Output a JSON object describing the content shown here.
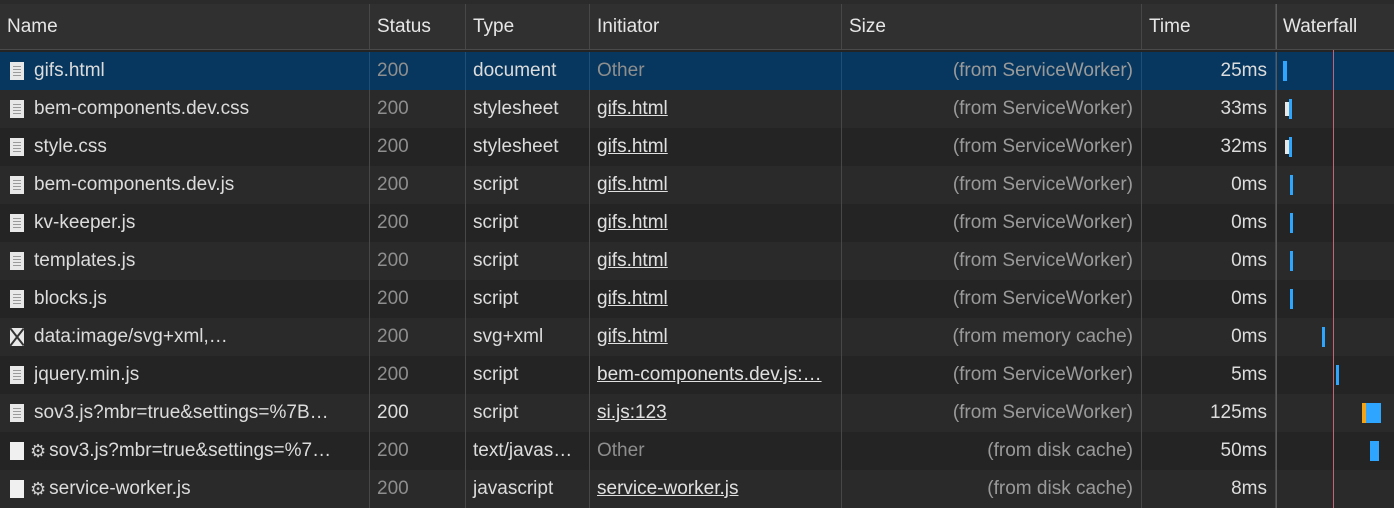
{
  "headers": {
    "name": "Name",
    "status": "Status",
    "type": "Type",
    "initiator": "Initiator",
    "size": "Size",
    "time": "Time",
    "waterfall": "Waterfall"
  },
  "rows": [
    {
      "name": "gifs.html",
      "icon": "document-icon",
      "status": "200",
      "type": "document",
      "initiator": "Other",
      "initiator_link": false,
      "size": "(from ServiceWorker)",
      "time": "25",
      "time_unit": "ms",
      "wf_start": 0.0,
      "wf_len": 0.03,
      "selected": true
    },
    {
      "name": "bem-components.dev.css",
      "icon": "document-icon",
      "status": "200",
      "type": "stylesheet",
      "initiator": "gifs.html",
      "initiator_link": true,
      "size": "(from ServiceWorker)",
      "time": "33",
      "time_unit": "ms",
      "wf_start": 0.05,
      "wf_len": 0.03
    },
    {
      "name": "style.css",
      "icon": "document-icon",
      "status": "200",
      "type": "stylesheet",
      "initiator": "gifs.html",
      "initiator_link": true,
      "size": "(from ServiceWorker)",
      "time": "32",
      "time_unit": "ms",
      "wf_start": 0.05,
      "wf_len": 0.03
    },
    {
      "name": "bem-components.dev.js",
      "icon": "document-icon",
      "status": "200",
      "type": "script",
      "initiator": "gifs.html",
      "initiator_link": true,
      "size": "(from ServiceWorker)",
      "time": "0",
      "time_unit": "ms",
      "wf_start": 0.06,
      "wf_len": 0.01
    },
    {
      "name": "kv-keeper.js",
      "icon": "document-icon",
      "status": "200",
      "type": "script",
      "initiator": "gifs.html",
      "initiator_link": true,
      "size": "(from ServiceWorker)",
      "time": "0",
      "time_unit": "ms",
      "wf_start": 0.06,
      "wf_len": 0.01
    },
    {
      "name": "templates.js",
      "icon": "document-icon",
      "status": "200",
      "type": "script",
      "initiator": "gifs.html",
      "initiator_link": true,
      "size": "(from ServiceWorker)",
      "time": "0",
      "time_unit": "ms",
      "wf_start": 0.06,
      "wf_len": 0.01
    },
    {
      "name": "blocks.js",
      "icon": "document-icon",
      "status": "200",
      "type": "script",
      "initiator": "gifs.html",
      "initiator_link": true,
      "size": "(from ServiceWorker)",
      "time": "0",
      "time_unit": "ms",
      "wf_start": 0.06,
      "wf_len": 0.01
    },
    {
      "name": "data:image/svg+xml,…",
      "icon": "image-icon",
      "status": "200",
      "type": "svg+xml",
      "initiator": "gifs.html",
      "initiator_link": true,
      "size": "(from memory cache)",
      "time": "0",
      "time_unit": "ms",
      "wf_start": 0.33,
      "wf_len": 0.01
    },
    {
      "name": "jquery.min.js",
      "icon": "document-icon",
      "status": "200",
      "type": "script",
      "initiator": "bem-components.dev.js:…",
      "initiator_link": true,
      "size": "(from ServiceWorker)",
      "time": "5",
      "time_unit": "ms",
      "wf_start": 0.45,
      "wf_len": 0.02
    },
    {
      "name": "sov3.js?mbr=true&settings=%7B…",
      "icon": "document-icon",
      "status": "200",
      "status_bright": true,
      "type": "script",
      "initiator": "si.js:123",
      "initiator_link": true,
      "size": "(from ServiceWorker)",
      "time": "125",
      "time_unit": "ms",
      "wf_start": 0.7,
      "wf_len": 0.13,
      "wf_orange": true
    },
    {
      "name": "sov3.js?mbr=true&settings=%7…",
      "icon": "blank-icon",
      "gear": true,
      "status": "200",
      "type": "text/javas…",
      "initiator": "Other",
      "initiator_link": false,
      "size": "(from disk cache)",
      "time": "50",
      "time_unit": "ms",
      "wf_start": 0.74,
      "wf_len": 0.07
    },
    {
      "name": "service-worker.js",
      "icon": "blank-icon",
      "gear": true,
      "status": "200",
      "type": "javascript",
      "initiator": "service-worker.js",
      "initiator_link": true,
      "size": "(from disk cache)",
      "time": "8",
      "time_unit": "ms",
      "wf_start": 0.0,
      "wf_len": 0.0
    }
  ],
  "waterfall_marker": 0.43,
  "colors": {
    "selected_row": "#07375e",
    "waterfall_bar": "#2ea6ff",
    "waterfall_wait": "#f3a316",
    "marker_line": "#c4627a"
  }
}
